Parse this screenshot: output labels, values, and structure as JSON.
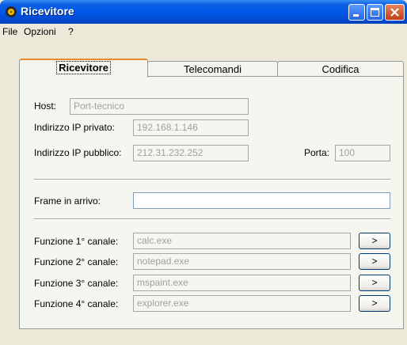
{
  "window": {
    "title": "Ricevitore"
  },
  "menu": {
    "file": "File",
    "options": "Opzioni",
    "help": "?"
  },
  "tabs": [
    {
      "label": "Ricevitore",
      "active": true
    },
    {
      "label": "Telecomandi",
      "active": false
    },
    {
      "label": "Codifica",
      "active": false
    }
  ],
  "receiver": {
    "host_label": "Host:",
    "host_value": "Port-tecnico",
    "ip_private_label": "Indirizzo IP privato:",
    "ip_private_value": "192.168.1.146",
    "ip_public_label": "Indirizzo IP pubblico:",
    "ip_public_value": "212.31.232.252",
    "port_label": "Porta:",
    "port_value": "100",
    "frame_label": "Frame in arrivo:",
    "frame_value": ""
  },
  "channels": [
    {
      "label": "Funzione 1° canale:",
      "value": "calc.exe",
      "button": ">"
    },
    {
      "label": "Funzione 2° canale:",
      "value": "notepad.exe",
      "button": ">"
    },
    {
      "label": "Funzione 3° canale:",
      "value": "mspaint.exe",
      "button": ">"
    },
    {
      "label": "Funzione 4° canale:",
      "value": "explorer.exe",
      "button": ">"
    }
  ],
  "colors": {
    "titlebar": "#0055E5",
    "active_tab_highlight": "#E68B2C",
    "disabled_text": "#A0A0A0"
  },
  "icons": {
    "app": "sun-gear-icon",
    "minimize": "minimize-icon",
    "maximize": "maximize-icon",
    "close": "close-icon"
  }
}
